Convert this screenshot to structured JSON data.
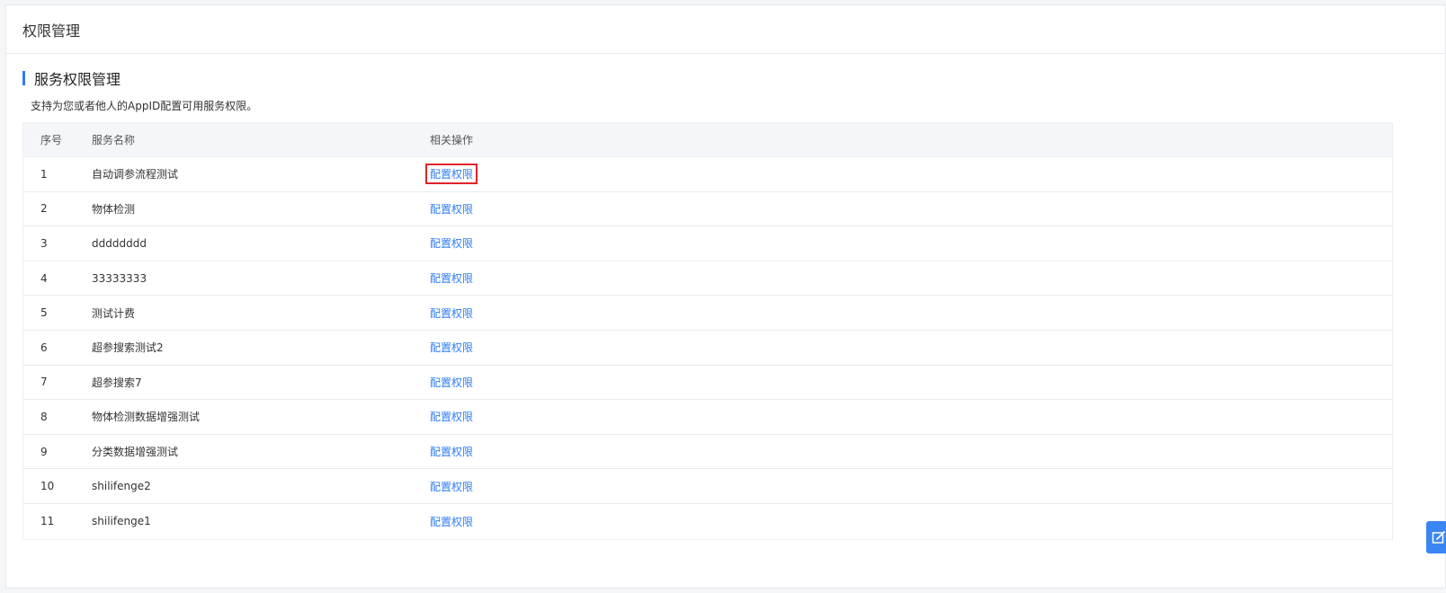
{
  "header": {
    "title": "权限管理"
  },
  "section": {
    "title": "服务权限管理",
    "description": "支持为您或者他人的AppID配置可用服务权限。"
  },
  "table": {
    "columns": {
      "index": "序号",
      "name": "服务名称",
      "action": "相关操作"
    },
    "rows": [
      {
        "index": "1",
        "name": "自动调参流程测试",
        "action": "配置权限"
      },
      {
        "index": "2",
        "name": "物体检测",
        "action": "配置权限"
      },
      {
        "index": "3",
        "name": "dddddddd",
        "action": "配置权限"
      },
      {
        "index": "4",
        "name": "33333333",
        "action": "配置权限"
      },
      {
        "index": "5",
        "name": "测试计费",
        "action": "配置权限"
      },
      {
        "index": "6",
        "name": "超参搜索测试2",
        "action": "配置权限"
      },
      {
        "index": "7",
        "name": "超参搜索7",
        "action": "配置权限"
      },
      {
        "index": "8",
        "name": "物体检测数据增强测试",
        "action": "配置权限"
      },
      {
        "index": "9",
        "name": "分类数据增强测试",
        "action": "配置权限"
      },
      {
        "index": "10",
        "name": "shilifenge2",
        "action": "配置权限"
      },
      {
        "index": "11",
        "name": "shilifenge1",
        "action": "配置权限"
      }
    ]
  },
  "colors": {
    "accent": "#2f7cf6",
    "highlight": "#e0242a"
  },
  "floating_button": {
    "icon": "edit-icon"
  }
}
